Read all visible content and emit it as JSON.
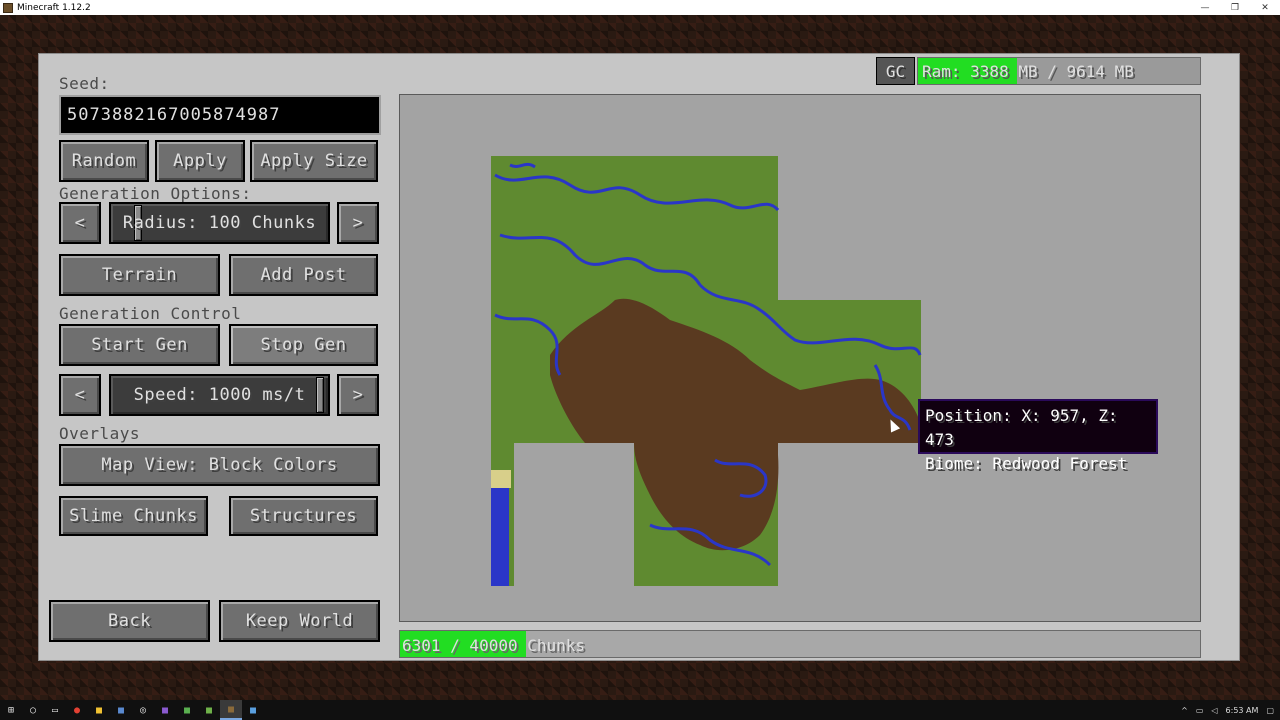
{
  "window": {
    "title": "Minecraft 1.12.2",
    "controls": [
      "—",
      "❐",
      "✕"
    ]
  },
  "left": {
    "seed_label": "Seed:",
    "seed_value": "5073882167005874987",
    "random_label": "Random",
    "apply_label": "Apply",
    "apply_size_label": "Apply Size",
    "generation_options_label": "Generation Options:",
    "radius_prev": "<",
    "radius_label": "Radius: 100 Chunks",
    "radius_next": ">",
    "terrain_label": "Terrain",
    "add_post_label": "Add Post",
    "generation_control_label": "Generation Control",
    "start_gen_label": "Start Gen",
    "stop_gen_label": "Stop Gen",
    "speed_prev": "<",
    "speed_label": "Speed: 1000 ms/t",
    "speed_next": ">",
    "overlays_label": "Overlays",
    "map_view_label": "Map View: Block Colors",
    "slime_chunks_label": "Slime Chunks",
    "structures_label": "Structures",
    "back_label": "Back",
    "keep_world_label": "Keep World"
  },
  "header": {
    "gc_label": "GC",
    "ram_used_text": "Ram: 3388",
    "ram_total_text": " MB / 9614 MB",
    "ram_used_mb": 3388,
    "ram_total_mb": 9614
  },
  "progress": {
    "done_text": "6301 / 40000",
    "suffix_text": " Chunks",
    "done": 6301,
    "total": 40000
  },
  "tooltip": {
    "position": "Position: X: 957, Z: 473",
    "biome": "Biome: Redwood Forest"
  },
  "map": {
    "colors": {
      "grass": "#5f8a30",
      "water": "#2a36c8",
      "redwood": "#5a3a20",
      "empty": "#a3a3a3",
      "sand": "#d8cf8a"
    }
  },
  "taskbar": {
    "time": "6:53 AM",
    "icons": [
      "windows-start",
      "search",
      "task-view",
      "chrome",
      "file-explorer",
      "app",
      "app",
      "app",
      "app",
      "minecraft",
      "minecraft-active",
      "app"
    ]
  }
}
